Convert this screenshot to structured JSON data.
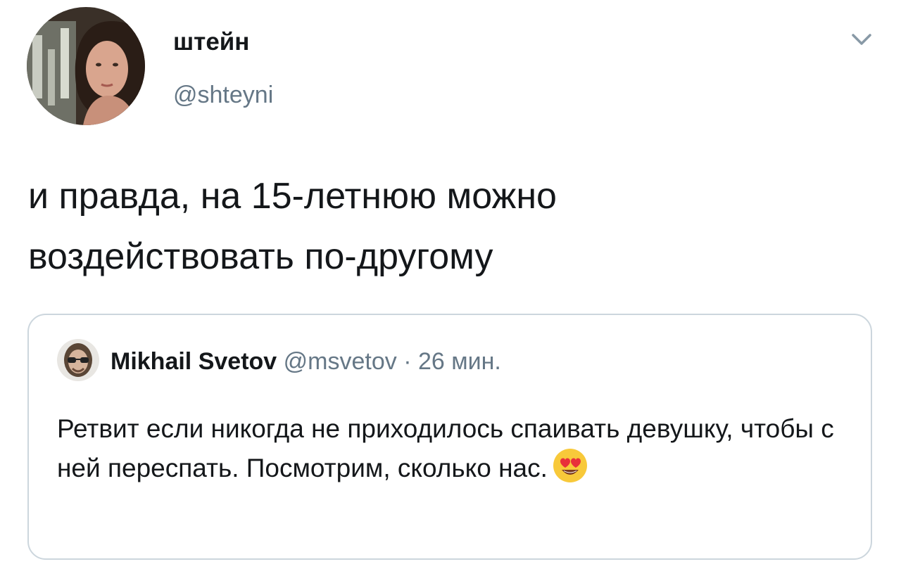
{
  "author": {
    "display_name": "штейн",
    "handle": "@shteyni"
  },
  "tweet": {
    "text": "и правда, на 15-летнюю можно\nвоздействовать по-другому"
  },
  "quoted_tweet": {
    "display_name": "Mikhail Svetov",
    "handle": "@msvetov",
    "separator": "·",
    "time": "26 мин.",
    "text": "Ретвит если никогда не приходилось спаивать девушку, чтобы с ней переспать. Посмотрим, сколько нас.",
    "emoji": "heart-eyes-emoji"
  },
  "icons": {
    "menu_caret": "chevron-down-icon"
  },
  "colors": {
    "text_primary": "#14171a",
    "text_secondary": "#657786",
    "border": "#ccd6dd"
  }
}
